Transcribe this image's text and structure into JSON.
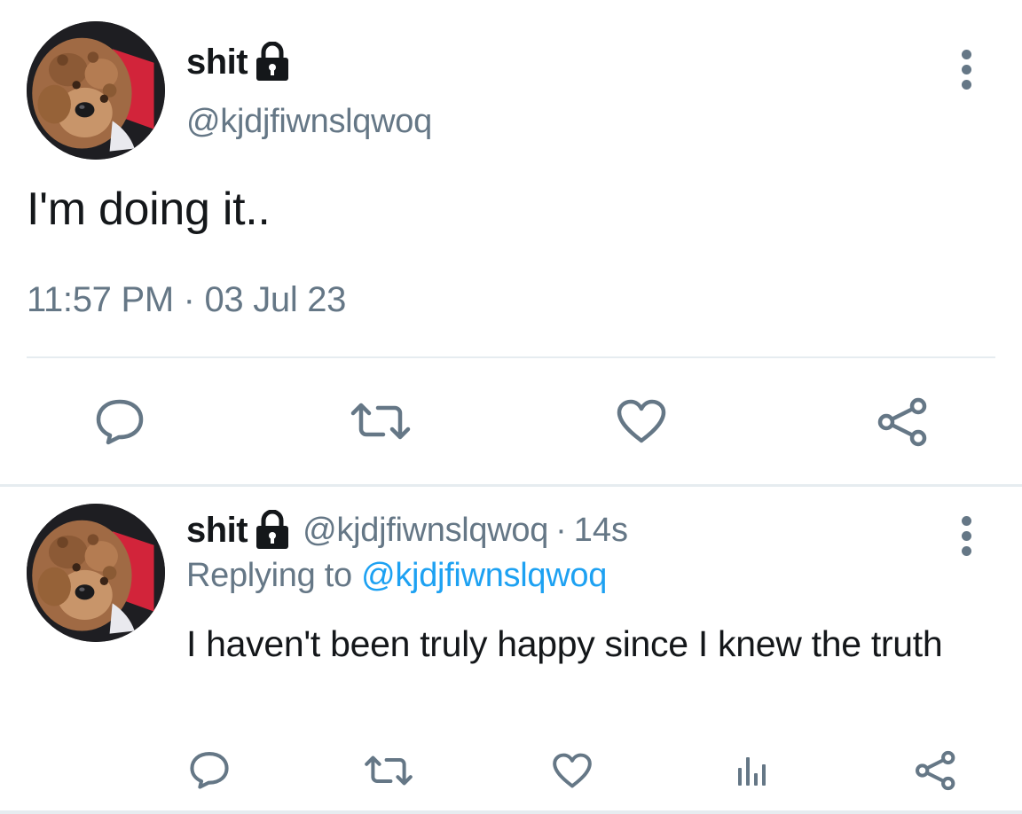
{
  "main_tweet": {
    "display_name": "shit",
    "handle": "@kjdjfiwnslqwoq",
    "text": "I'm doing it..",
    "timestamp": "11:57 PM · 03 Jul 23",
    "actions": [
      "reply-icon",
      "retweet-icon",
      "like-icon",
      "share-icon"
    ]
  },
  "reply_tweet": {
    "display_name": "shit",
    "handle": "@kjdjfiwnslqwoq",
    "separator": "·",
    "time_ago": "14s",
    "replying_prefix": "Replying to",
    "replying_handle": "@kjdjfiwnslqwoq",
    "text": "I haven't been truly happy since I knew the truth",
    "actions": [
      "reply-icon",
      "retweet-icon",
      "like-icon",
      "analytics-icon",
      "share-icon"
    ]
  },
  "colors": {
    "text_primary": "#14171a",
    "text_secondary": "#657786",
    "link": "#1da1f2",
    "divider": "#e6ecf0"
  }
}
